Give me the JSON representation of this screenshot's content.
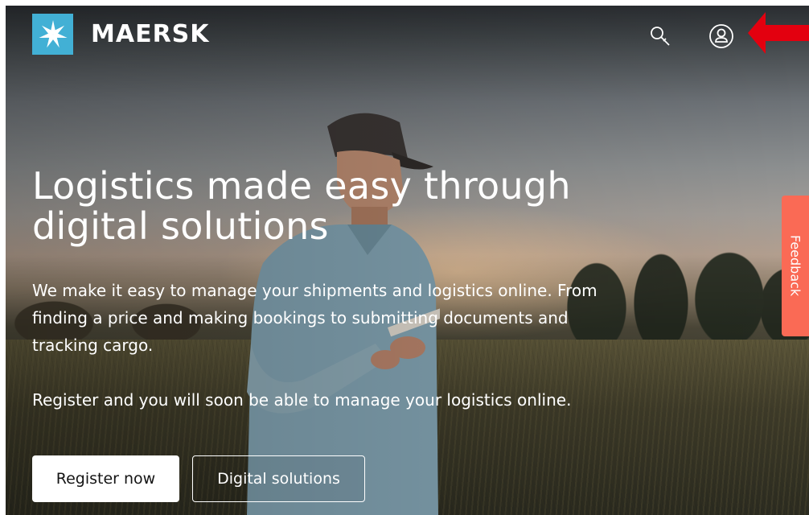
{
  "header": {
    "brand_name": "MAERSK",
    "search_icon": "search-icon",
    "account_icon": "user-account-icon"
  },
  "hero": {
    "title": "Logistics made easy through digital solutions",
    "description": "We make it easy to manage your shipments and logistics online. From finding a price and making bookings to submitting documents and tracking cargo.",
    "register_text": "Register and you will soon be able to manage your logistics online.",
    "register_button": "Register now",
    "digital_button": "Digital solutions"
  },
  "feedback": {
    "label": "Feedback"
  },
  "colors": {
    "brand_blue": "#42b0d5",
    "feedback_coral": "#fa6a55",
    "annotation_red": "#e3000f"
  }
}
